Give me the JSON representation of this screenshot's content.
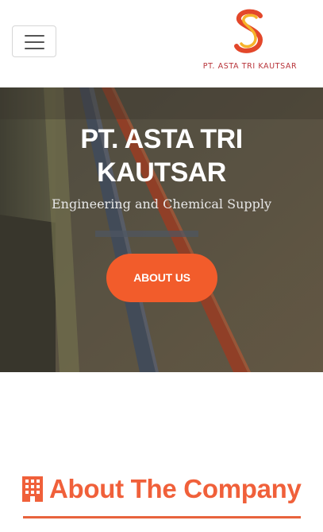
{
  "header": {
    "menu_toggle": "hamburger-icon",
    "brand_name": "PT. ASTA TRI KAUTSAR",
    "brand_colors": {
      "primary": "#e3472a",
      "secondary": "#f6b32b",
      "text": "#b8343a"
    }
  },
  "hero": {
    "title": "PT. ASTA TRI KAUTSAR",
    "subtitle": "Engineering and Chemical Supply",
    "cta_label": "ABOUT US",
    "accent": "#f25c2b"
  },
  "about": {
    "icon": "building-icon",
    "title": "About The Company",
    "accent": "#f0603a"
  }
}
